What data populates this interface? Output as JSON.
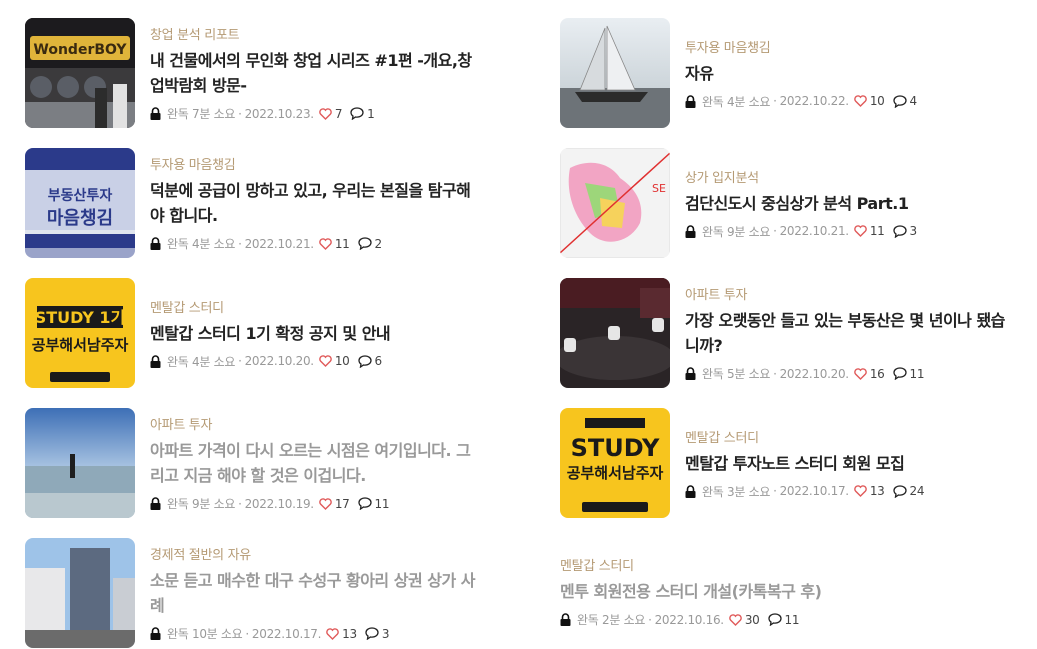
{
  "posts_left": [
    {
      "category": "창업 분석 리포트",
      "title": "내 건물에서의 무인화 창업 시리즈 #1편 -개요,창업박람회 방문-",
      "status": "완독",
      "read_time": "7분 소요",
      "date": "2022.10.23.",
      "likes": "7",
      "comments": "1",
      "thumb": "thumb-expo",
      "thumb_text": "WonderBOY",
      "faded": false
    },
    {
      "category": "투자용 마음챙김",
      "title": "덕분에 공급이 망하고 있고, 우리는 본질을 탐구해야 합니다.",
      "status": "완독",
      "read_time": "4분 소요",
      "date": "2022.10.21.",
      "likes": "11",
      "comments": "2",
      "thumb": "thumb-mind",
      "thumb_text": "부동산투자 마음챙김",
      "faded": false
    },
    {
      "category": "멘탈갑 스터디",
      "title": "멘탈갑 스터디 1기 확정 공지 및 안내",
      "status": "완독",
      "read_time": "4분 소요",
      "date": "2022.10.20.",
      "likes": "10",
      "comments": "6",
      "thumb": "thumb-study1",
      "thumb_text": "STUDY 1기",
      "faded": false
    },
    {
      "category": "아파트 투자",
      "title": "아파트 가격이 다시 오르는 시점은 여기입니다. 그리고 지금 해야 할 것은 이겁니다.",
      "status": "완독",
      "read_time": "9분 소요",
      "date": "2022.10.19.",
      "likes": "17",
      "comments": "11",
      "thumb": "thumb-sea",
      "thumb_text": "",
      "faded": true
    },
    {
      "category": "경제적 절반의 자유",
      "title": "소문 듣고 매수한 대구 수성구 황아리 상권 상가 사례",
      "status": "완독",
      "read_time": "10분 소요",
      "date": "2022.10.17.",
      "likes": "13",
      "comments": "3",
      "thumb": "thumb-street",
      "thumb_text": "",
      "faded": true
    }
  ],
  "posts_right": [
    {
      "category": "투자용 마음챙김",
      "title": "자유",
      "status": "완독",
      "read_time": "4분 소요",
      "date": "2022.10.22.",
      "likes": "10",
      "comments": "4",
      "thumb": "thumb-sail",
      "thumb_text": "",
      "faded": false
    },
    {
      "category": "상가 입지분석",
      "title": "검단신도시 중심상가 분석 Part.1",
      "status": "완독",
      "read_time": "9분 소요",
      "date": "2022.10.21.",
      "likes": "11",
      "comments": "3",
      "thumb": "thumb-map",
      "thumb_text": "SE",
      "faded": false
    },
    {
      "category": "아파트 투자",
      "title": "가장 오랫동안 들고 있는 부동산은 몇 년이나 됐습니까?",
      "status": "완독",
      "read_time": "5분 소요",
      "date": "2022.10.20.",
      "likes": "16",
      "comments": "11",
      "thumb": "thumb-cups",
      "thumb_text": "",
      "faded": false
    },
    {
      "category": "멘탈갑 스터디",
      "title": "멘탈갑 투자노트 스터디 회원 모집",
      "status": "완독",
      "read_time": "3분 소요",
      "date": "2022.10.17.",
      "likes": "13",
      "comments": "24",
      "thumb": "thumb-study2",
      "thumb_text": "STUDY",
      "faded": false
    },
    {
      "category": "멘탈갑 스터디",
      "title": "멘투 회원전용 스터디 개설(카톡복구 후)",
      "status": "완독",
      "read_time": "2분 소요",
      "date": "2022.10.16.",
      "likes": "30",
      "comments": "11",
      "thumb": "none",
      "thumb_text": "",
      "faded": true
    }
  ],
  "colors": {
    "category": "#b59a74",
    "title": "#222222",
    "faded_title": "#999999",
    "meta": "#999999",
    "heart": "#e05a5a",
    "study_yellow": "#f7c51e"
  },
  "icons": {
    "lock": "lock-icon",
    "heart": "heart-icon",
    "comment": "comment-icon"
  }
}
